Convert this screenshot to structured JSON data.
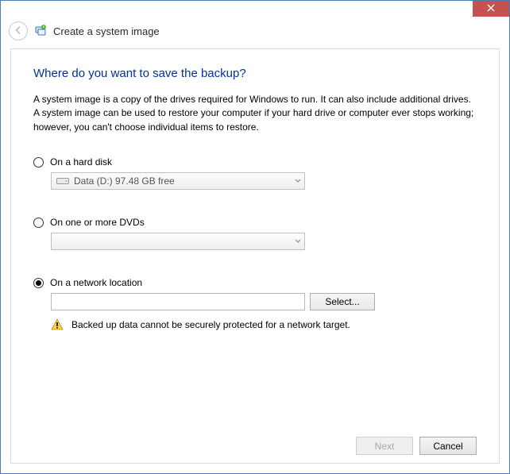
{
  "window": {
    "title": "Create a system image"
  },
  "page": {
    "question": "Where do you want to save the backup?",
    "description": "A system image is a copy of the drives required for Windows to run. It can also include additional drives. A system image can be used to restore your computer if your hard drive or computer ever stops working; however, you can't choose individual items to restore."
  },
  "options": {
    "hard_disk": {
      "label": "On a hard disk",
      "selected": false,
      "drive_display": "Data (D:)  97.48 GB free"
    },
    "dvd": {
      "label": "On one or more DVDs",
      "selected": false,
      "drive_display": ""
    },
    "network": {
      "label": "On a network location",
      "selected": true,
      "path_value": "",
      "select_button": "Select...",
      "warning": "Backed up data cannot be securely protected for a network target."
    }
  },
  "footer": {
    "next": "Next",
    "next_enabled": false,
    "cancel": "Cancel"
  }
}
